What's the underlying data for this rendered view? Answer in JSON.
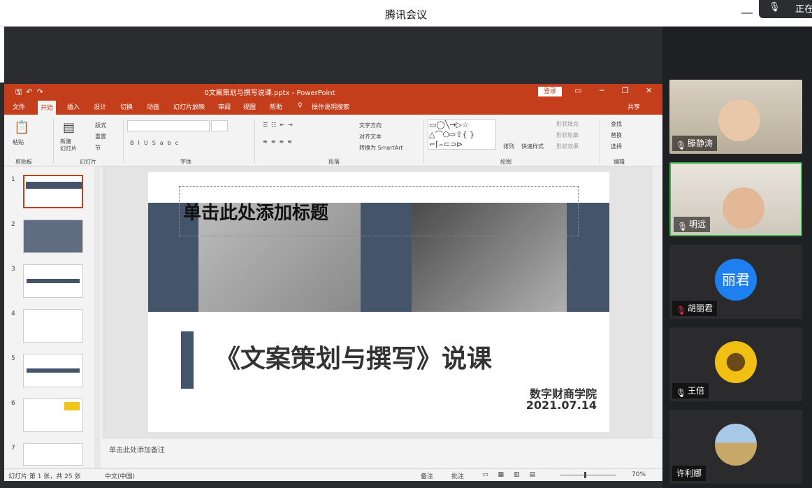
{
  "window": {
    "title": "腾讯会议",
    "mic_status": "正在"
  },
  "ppt": {
    "doc_title": "0文案策划与撰写说课.pptx - PowerPoint",
    "login_label": "登录",
    "tabs": [
      "文件",
      "开始",
      "插入",
      "设计",
      "切换",
      "动画",
      "幻灯片放映",
      "审阅",
      "视图",
      "帮助"
    ],
    "search_hint": "操作说明搜索",
    "share_label": "共享",
    "groups": {
      "clipboard": "剪贴板",
      "slides": "幻灯片",
      "font": "字体",
      "paragraph": "段落",
      "drawing": "绘图",
      "editing": "编辑"
    },
    "buttons": {
      "paste": "粘贴",
      "new_slide": "新建\n幻灯片",
      "layout": "版式",
      "reset": "重置",
      "section": "节",
      "text_direction": "文字方向",
      "align_text": "对齐文本",
      "smartart": "转换为 SmartArt",
      "arrange": "排列",
      "quick_styles": "快速样式",
      "shape_fill": "形状填充",
      "shape_outline": "形状轮廓",
      "shape_effects": "形状效果",
      "find": "查找",
      "replace": "替换",
      "select": "选择"
    },
    "thumb_numbers": [
      "1",
      "2",
      "3",
      "4",
      "5",
      "6",
      "7"
    ],
    "slide": {
      "placeholder_text": "单击此处添加标题",
      "title": "《文案策划与撰写》说课",
      "org": "数字财商学院",
      "date": "2021.07.14"
    },
    "notes_placeholder": "单击此处添加备注",
    "status": {
      "slide_info": "幻灯片 第 1 张，共 25 张",
      "language": "中文(中国)",
      "notes": "备注",
      "comments": "批注",
      "zoom": "70%"
    }
  },
  "participants": [
    {
      "name": "滕静涛",
      "type": "video"
    },
    {
      "name": "明远",
      "type": "video",
      "active": true
    },
    {
      "name": "胡丽君",
      "type": "avatar-text",
      "avatar_text": "丽君",
      "muted": true
    },
    {
      "name": "王倍",
      "type": "avatar-image"
    },
    {
      "name": "许利娜",
      "type": "avatar-image"
    }
  ],
  "colors": {
    "ppt_accent": "#c43e1c",
    "slide_band": "#44546a",
    "avatar_blue": "#1e80f0",
    "active_border": "#35b34a"
  }
}
